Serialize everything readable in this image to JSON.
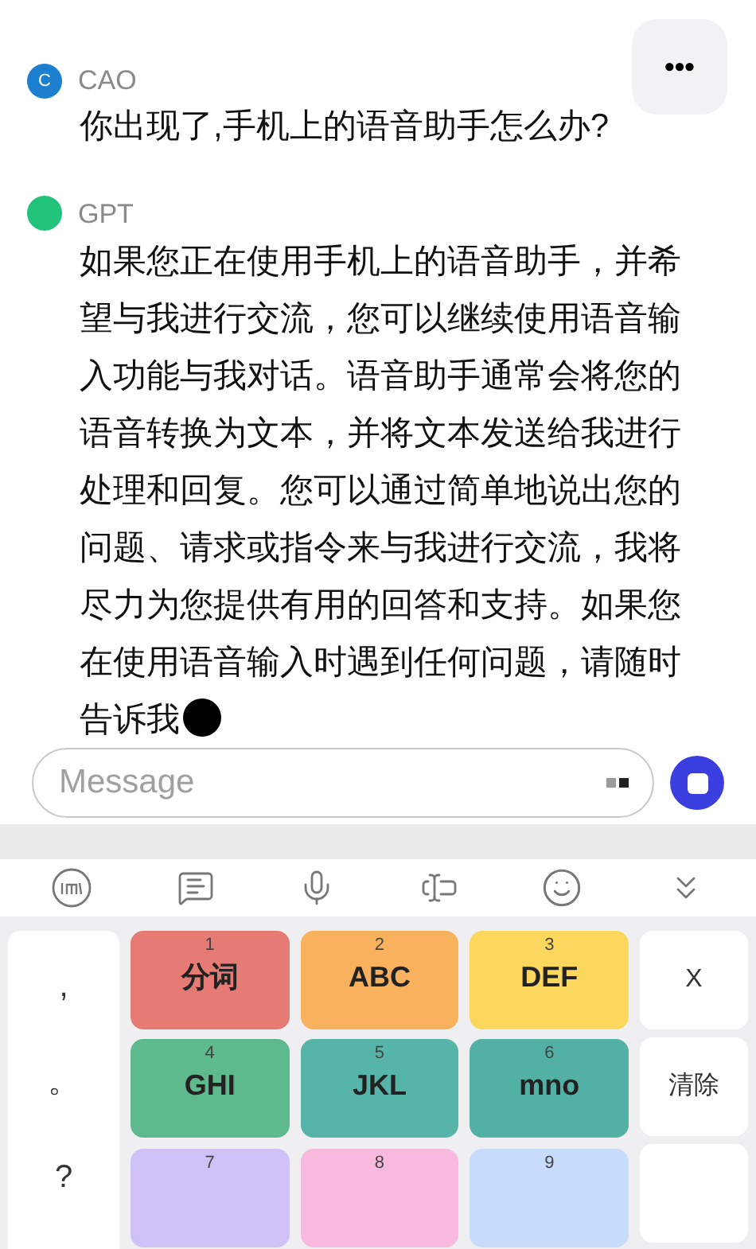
{
  "more_button": {
    "label": "•••"
  },
  "messages": [
    {
      "kind": "user",
      "author": "CAO",
      "avatar_letter": "C",
      "color": "#1d7fd0",
      "text": "你出现了,手机上的语音助手怎么办?"
    },
    {
      "kind": "bot",
      "author": "GPT",
      "color": "#21c27a",
      "text": "如果您正在使用手机上的语音助手，并希望与我进行交流，您可以继续使用语音输入功能与我对话。语音助手通常会将您的语音转换为文本，并将文本发送给我进行处理和回复。您可以通过简单地说出您的问题、请求或指令来与我进行交流，我将尽力为您提供有用的回答和支持。如果您在使用语音输入时遇到任何问题，请随时告诉我",
      "streaming": true
    }
  ],
  "composer": {
    "placeholder": "Message"
  },
  "keyboard": {
    "punctuation": [
      ",",
      "。",
      "?"
    ],
    "keys": [
      {
        "number": "1",
        "label": "分词",
        "color": "#e57b74"
      },
      {
        "number": "2",
        "label": "ABC",
        "color": "#f8b15c"
      },
      {
        "number": "3",
        "label": "DEF",
        "color": "#fcd75d"
      },
      {
        "number": "4",
        "label": "GHI",
        "color": "#5fb98f"
      },
      {
        "number": "5",
        "label": "JKL",
        "color": "#56b4a9"
      },
      {
        "number": "6",
        "label": "mno",
        "color": "#53b0a5"
      },
      {
        "number": "7",
        "color": "#cfc0f6"
      },
      {
        "number": "8",
        "color": "#f7b9dd"
      },
      {
        "number": "9",
        "color": "#c7dcfb"
      }
    ],
    "side_keys": [
      "X",
      "清除"
    ]
  }
}
